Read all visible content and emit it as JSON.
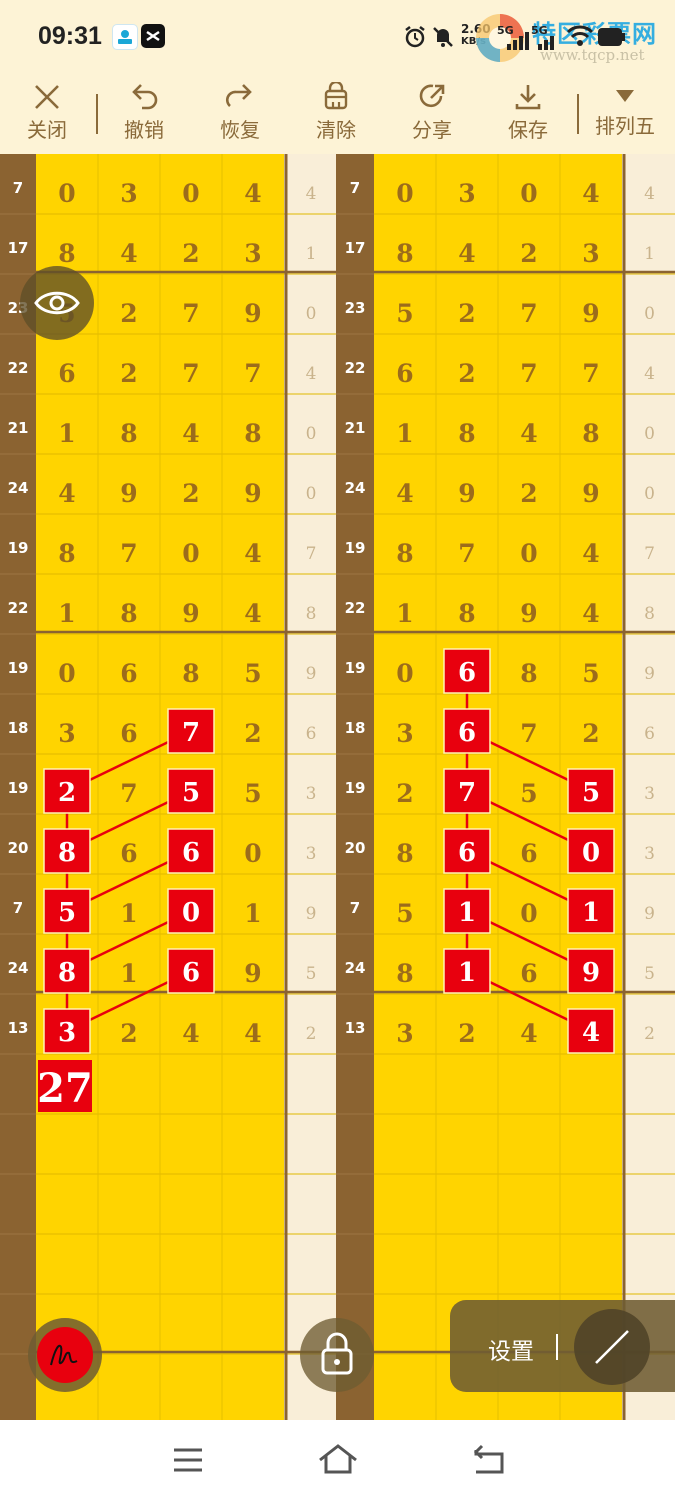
{
  "status": {
    "time": "09:31",
    "net_speed": "2.60",
    "net_unit": "KB/s",
    "sig1": "5G",
    "sig2": "5G"
  },
  "watermark": {
    "text": "特区彩票网",
    "url": "www.tqcp.net"
  },
  "toolbar": {
    "close": "关闭",
    "undo": "撤销",
    "redo": "恢复",
    "clear": "清除",
    "share": "分享",
    "save": "保存",
    "mode": "排列五"
  },
  "colors": {
    "yellow": "#ffd400",
    "brown": "#8b6331",
    "cream": "#f9eed8",
    "red": "#e8000e",
    "digit": "#8b5a20"
  },
  "panels": [
    {
      "rows": [
        {
          "sum": "7",
          "d": [
            "0",
            "3",
            "0",
            "4"
          ],
          "s": "4"
        },
        {
          "sum": "17",
          "d": [
            "8",
            "4",
            "2",
            "3"
          ],
          "s": "1"
        },
        {
          "sum": "23",
          "d": [
            "5",
            "2",
            "7",
            "9"
          ],
          "s": "0"
        },
        {
          "sum": "22",
          "d": [
            "6",
            "2",
            "7",
            "7"
          ],
          "s": "4"
        },
        {
          "sum": "21",
          "d": [
            "1",
            "8",
            "4",
            "8"
          ],
          "s": "0"
        },
        {
          "sum": "24",
          "d": [
            "4",
            "9",
            "2",
            "9"
          ],
          "s": "0"
        },
        {
          "sum": "19",
          "d": [
            "8",
            "7",
            "0",
            "4"
          ],
          "s": "7"
        },
        {
          "sum": "22",
          "d": [
            "1",
            "8",
            "9",
            "4"
          ],
          "s": "8"
        },
        {
          "sum": "19",
          "d": [
            "0",
            "6",
            "8",
            "5"
          ],
          "s": "9"
        },
        {
          "sum": "18",
          "d": [
            "3",
            "6",
            "7",
            "2"
          ],
          "s": "6"
        },
        {
          "sum": "19",
          "d": [
            "2",
            "7",
            "5",
            "5"
          ],
          "s": "3"
        },
        {
          "sum": "20",
          "d": [
            "8",
            "6",
            "6",
            "0"
          ],
          "s": "3"
        },
        {
          "sum": "7",
          "d": [
            "5",
            "1",
            "0",
            "1"
          ],
          "s": "9"
        },
        {
          "sum": "24",
          "d": [
            "8",
            "1",
            "6",
            "9"
          ],
          "s": "5"
        },
        {
          "sum": "13",
          "d": [
            "3",
            "2",
            "4",
            "4"
          ],
          "s": "2"
        }
      ],
      "marks": [
        [
          9,
          2
        ],
        [
          10,
          0
        ],
        [
          10,
          2
        ],
        [
          11,
          0
        ],
        [
          11,
          2
        ],
        [
          12,
          0
        ],
        [
          12,
          2
        ],
        [
          13,
          0
        ],
        [
          13,
          2
        ],
        [
          14,
          0
        ]
      ],
      "lines": [
        [
          [
            10,
            0
          ],
          [
            9,
            2
          ]
        ],
        [
          [
            11,
            0
          ],
          [
            10,
            2
          ]
        ],
        [
          [
            12,
            0
          ],
          [
            11,
            2
          ]
        ],
        [
          [
            13,
            0
          ],
          [
            12,
            2
          ]
        ],
        [
          [
            14,
            0
          ],
          [
            13,
            2
          ]
        ],
        [
          [
            10,
            0
          ],
          [
            14,
            0
          ]
        ]
      ],
      "total": "27"
    },
    {
      "rows": [
        {
          "sum": "7",
          "d": [
            "0",
            "3",
            "0",
            "4"
          ],
          "s": "4"
        },
        {
          "sum": "17",
          "d": [
            "8",
            "4",
            "2",
            "3"
          ],
          "s": "1"
        },
        {
          "sum": "23",
          "d": [
            "5",
            "2",
            "7",
            "9"
          ],
          "s": "0"
        },
        {
          "sum": "22",
          "d": [
            "6",
            "2",
            "7",
            "7"
          ],
          "s": "4"
        },
        {
          "sum": "21",
          "d": [
            "1",
            "8",
            "4",
            "8"
          ],
          "s": "0"
        },
        {
          "sum": "24",
          "d": [
            "4",
            "9",
            "2",
            "9"
          ],
          "s": "0"
        },
        {
          "sum": "19",
          "d": [
            "8",
            "7",
            "0",
            "4"
          ],
          "s": "7"
        },
        {
          "sum": "22",
          "d": [
            "1",
            "8",
            "9",
            "4"
          ],
          "s": "8"
        },
        {
          "sum": "19",
          "d": [
            "0",
            "6",
            "8",
            "5"
          ],
          "s": "9"
        },
        {
          "sum": "18",
          "d": [
            "3",
            "6",
            "7",
            "2"
          ],
          "s": "6"
        },
        {
          "sum": "19",
          "d": [
            "2",
            "7",
            "5",
            "5"
          ],
          "s": "3"
        },
        {
          "sum": "20",
          "d": [
            "8",
            "6",
            "6",
            "0"
          ],
          "s": "3"
        },
        {
          "sum": "7",
          "d": [
            "5",
            "1",
            "0",
            "1"
          ],
          "s": "9"
        },
        {
          "sum": "24",
          "d": [
            "8",
            "1",
            "6",
            "9"
          ],
          "s": "5"
        },
        {
          "sum": "13",
          "d": [
            "3",
            "2",
            "4",
            "4"
          ],
          "s": "2"
        }
      ],
      "marks": [
        [
          8,
          1
        ],
        [
          9,
          1
        ],
        [
          10,
          1
        ],
        [
          11,
          1
        ],
        [
          12,
          1
        ],
        [
          13,
          1
        ],
        [
          10,
          3
        ],
        [
          11,
          3
        ],
        [
          12,
          3
        ],
        [
          13,
          3
        ],
        [
          14,
          3
        ]
      ],
      "lines": [
        [
          [
            8,
            1
          ],
          [
            13,
            1
          ]
        ],
        [
          [
            9,
            1
          ],
          [
            10,
            3
          ]
        ],
        [
          [
            10,
            1
          ],
          [
            11,
            3
          ]
        ],
        [
          [
            11,
            1
          ],
          [
            12,
            3
          ]
        ],
        [
          [
            12,
            1
          ],
          [
            13,
            3
          ]
        ],
        [
          [
            13,
            1
          ],
          [
            14,
            3
          ]
        ]
      ],
      "total": ""
    }
  ],
  "settings": {
    "label": "设置"
  }
}
